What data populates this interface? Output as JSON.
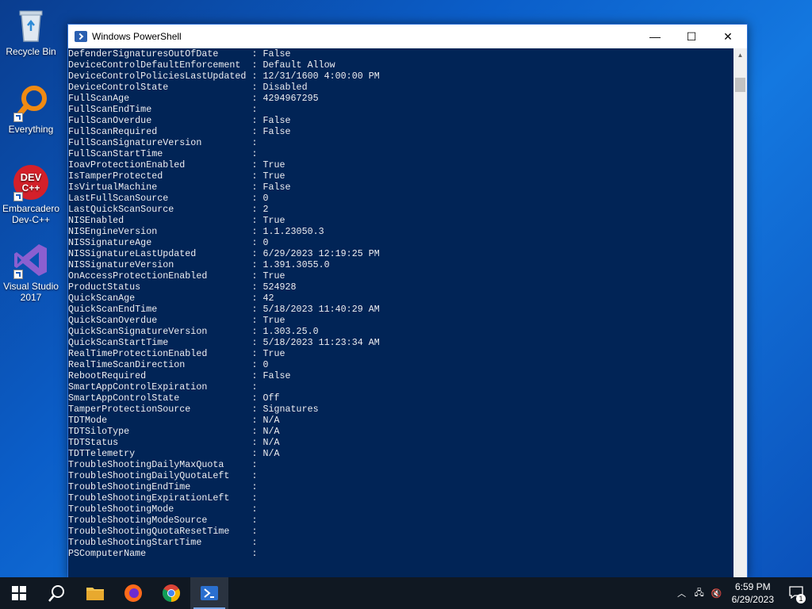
{
  "desktop": {
    "icons": [
      {
        "label": "Recycle Bin"
      },
      {
        "label": "Everything"
      },
      {
        "label": "Embarcadero Dev-C++"
      },
      {
        "label": "Visual Studio 2017"
      }
    ]
  },
  "window": {
    "title": "Windows PowerShell",
    "minimize": "—",
    "maximize": "☐",
    "close": "✕"
  },
  "console": {
    "lines": [
      "DefenderSignaturesOutOfDate      : False",
      "DeviceControlDefaultEnforcement  : Default Allow",
      "DeviceControlPoliciesLastUpdated : 12/31/1600 4:00:00 PM",
      "DeviceControlState               : Disabled",
      "FullScanAge                      : 4294967295",
      "FullScanEndTime                  :",
      "FullScanOverdue                  : False",
      "FullScanRequired                 : False",
      "FullScanSignatureVersion         :",
      "FullScanStartTime                :",
      "IoavProtectionEnabled            : True",
      "IsTamperProtected                : True",
      "IsVirtualMachine                 : False",
      "LastFullScanSource               : 0",
      "LastQuickScanSource              : 2",
      "NISEnabled                       : True",
      "NISEngineVersion                 : 1.1.23050.3",
      "NISSignatureAge                  : 0",
      "NISSignatureLastUpdated          : 6/29/2023 12:19:25 PM",
      "NISSignatureVersion              : 1.391.3055.0",
      "OnAccessProtectionEnabled        : True",
      "ProductStatus                    : 524928",
      "QuickScanAge                     : 42",
      "QuickScanEndTime                 : 5/18/2023 11:40:29 AM",
      "QuickScanOverdue                 : True",
      "QuickScanSignatureVersion        : 1.303.25.0",
      "QuickScanStartTime               : 5/18/2023 11:23:34 AM",
      "RealTimeProtectionEnabled        : True",
      "RealTimeScanDirection            : 0",
      "RebootRequired                   : False",
      "SmartAppControlExpiration        :",
      "SmartAppControlState             : Off",
      "TamperProtectionSource           : Signatures",
      "TDTMode                          : N/A",
      "TDTSiloType                      : N/A",
      "TDTStatus                        : N/A",
      "TDTTelemetry                     : N/A",
      "TroubleShootingDailyMaxQuota     :",
      "TroubleShootingDailyQuotaLeft    :",
      "TroubleShootingEndTime           :",
      "TroubleShootingExpirationLeft    :",
      "TroubleShootingMode              :",
      "TroubleShootingModeSource        :",
      "TroubleShootingQuotaResetTime    :",
      "TroubleShootingStartTime         :",
      "PSComputerName                   :"
    ]
  },
  "taskbar": {
    "time": "6:59 PM",
    "date": "6/29/2023",
    "notification_count": "1",
    "colors": {
      "taskbar_bg": "#101822",
      "console_bg": "#012456"
    }
  }
}
